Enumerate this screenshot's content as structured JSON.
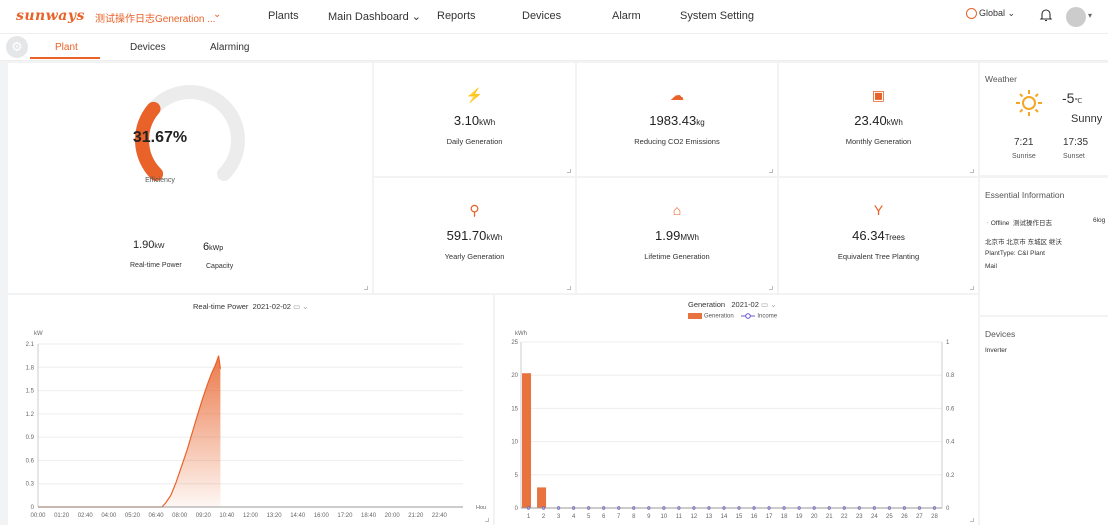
{
  "app": {
    "logo": "sunways",
    "plant_select": "测试操作日志Generation ...",
    "nav": [
      "Plants",
      "Main Dashboard",
      "Reports",
      "Devices",
      "Alarm",
      "System Setting"
    ],
    "nav_dropdown_marker": "⌄",
    "global_label": "Global"
  },
  "tabs": [
    "Plant",
    "Devices",
    "Alarming"
  ],
  "efficiency": {
    "value": "31.67%",
    "label": "Efficiency",
    "fraction": 0.3167
  },
  "realtime_power": {
    "value": "1.90",
    "unit": "kW",
    "label": "Real-time Power"
  },
  "capacity": {
    "value": "6",
    "unit": "kWp",
    "label": "Capacity"
  },
  "metrics": [
    {
      "icon": "lightning-leaf-icon",
      "glyph": "⚡",
      "value": "3.10",
      "unit": "kWh",
      "label": "Daily Generation"
    },
    {
      "icon": "cloud-co2-icon",
      "glyph": "☁",
      "value": "1983.43",
      "unit": "kg",
      "label": "Reducing CO2 Emissions"
    },
    {
      "icon": "calendar-icon",
      "glyph": "▣",
      "value": "23.40",
      "unit": "kWh",
      "label": "Monthly Generation"
    },
    {
      "icon": "yearly-plug-icon",
      "glyph": "⚲",
      "value": "591.70",
      "unit": "kWh",
      "label": "Yearly Generation"
    },
    {
      "icon": "home-icon",
      "glyph": "⌂",
      "value": "1.99",
      "unit": "MWh",
      "label": "Lifetime Generation"
    },
    {
      "icon": "tree-icon",
      "glyph": "Y",
      "value": "46.34",
      "unit": "Trees",
      "label": "Equivalent Tree Planting"
    }
  ],
  "weather": {
    "title": "Weather",
    "temp": "-5",
    "temp_unit": "℃",
    "condition": "Sunny",
    "sunrise": "7:21",
    "sunrise_label": "Sunrise",
    "sunset": "17:35",
    "sunset_label": "Sunset"
  },
  "essential": {
    "title": "Essential Information",
    "status": "Offline",
    "plant_name": "测试操作日志",
    "extra": "6log",
    "address": "北京市 北京市 东城区 继沃",
    "plant_type": "PlantType: C&I Plant",
    "mail": "Mail"
  },
  "devices": {
    "title": "Devices",
    "item": "Inverter"
  },
  "power_chart_header": {
    "title": "Real-time Power",
    "date": "2021-02-02"
  },
  "gen_chart_header": {
    "title": "Generation",
    "date": "2021-02",
    "legend_gen": "Generation",
    "legend_income": "Income"
  },
  "chart_data": [
    {
      "type": "area",
      "title": "Real-time Power",
      "ylabel": "kW",
      "xlabel": "Hou",
      "ylim": [
        0,
        2.1
      ],
      "yticks": [
        "0",
        "0.3",
        "0.6",
        "0.9",
        "1.2",
        "1.5",
        "1.8",
        "2.1"
      ],
      "xticks": [
        "00:00",
        "01:20",
        "02:40",
        "04:00",
        "05:20",
        "06:40",
        "08:00",
        "09:20",
        "10:40",
        "12:00",
        "13:20",
        "14:40",
        "16:00",
        "17:20",
        "18:40",
        "20:00",
        "21:20",
        "22:40"
      ],
      "x_hours": [
        0,
        1,
        2,
        3,
        4,
        5,
        6,
        7,
        7.2,
        7.5,
        7.8,
        8.1,
        8.4,
        8.7,
        9.0,
        9.3,
        9.6,
        9.8,
        10.0,
        10.1,
        10.2,
        10.25,
        10.3
      ],
      "values": [
        0,
        0,
        0,
        0,
        0,
        0,
        0,
        0,
        0.05,
        0.15,
        0.32,
        0.52,
        0.72,
        0.95,
        1.18,
        1.4,
        1.6,
        1.72,
        1.82,
        1.88,
        1.95,
        1.86,
        1.78
      ],
      "grid": true
    },
    {
      "type": "bar",
      "title": "Generation",
      "ylabel": "kWh",
      "ylim": [
        0,
        25
      ],
      "y2lim": [
        0,
        1
      ],
      "yticks": [
        "0",
        "5",
        "10",
        "15",
        "20",
        "25"
      ],
      "y2ticks": [
        "0",
        "0.2",
        "0.4",
        "0.6",
        "0.8",
        "1"
      ],
      "categories": [
        "1",
        "2",
        "3",
        "4",
        "5",
        "6",
        "7",
        "8",
        "9",
        "10",
        "11",
        "12",
        "13",
        "14",
        "15",
        "16",
        "17",
        "18",
        "19",
        "20",
        "21",
        "22",
        "23",
        "24",
        "25",
        "26",
        "27",
        "28"
      ],
      "series": [
        {
          "name": "Generation",
          "values": [
            20.3,
            3.1,
            0,
            0,
            0,
            0,
            0,
            0,
            0,
            0,
            0,
            0,
            0,
            0,
            0,
            0,
            0,
            0,
            0,
            0,
            0,
            0,
            0,
            0,
            0,
            0,
            0,
            0
          ]
        },
        {
          "name": "Income",
          "values": [
            0,
            0,
            0,
            0,
            0,
            0,
            0,
            0,
            0,
            0,
            0,
            0,
            0,
            0,
            0,
            0,
            0,
            0,
            0,
            0,
            0,
            0,
            0,
            0,
            0,
            0,
            0,
            0
          ]
        }
      ],
      "legend": "top-center",
      "grid": true
    }
  ],
  "colors": {
    "accent": "#e8622a",
    "income": "#6a5acd"
  }
}
